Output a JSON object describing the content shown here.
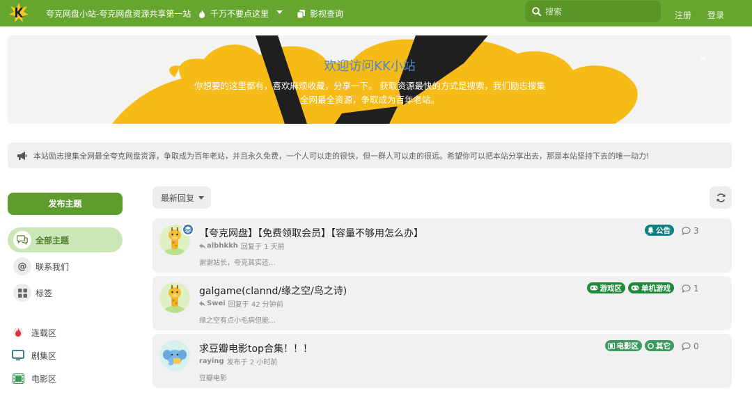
{
  "header": {
    "site_title": "夸克网盘小站-夸克网盘资源共享第一站",
    "nav": [
      {
        "label": "千万不要点这里",
        "icon": "fire-icon"
      },
      {
        "label": "影视查询",
        "icon": "copy-icon"
      }
    ],
    "search_placeholder": "搜索",
    "register": "注册",
    "login": "登录"
  },
  "hero": {
    "title": "欢迎访问KK小站",
    "text": "你想要的这里都有，喜欢麻烦收藏，分享一下。 获取资源最快的方式是搜索，我们励志搜集全网最全资源，争取成为百年老站。",
    "close": "×"
  },
  "notice": {
    "text": "本站励志搜集全网最全夸克网盘资源，争取成为百年老站，并且永久免费，一个人可以走的很快，但一群人可以走的很远。希望你可以把本站分享出去，那是本站坚持下去的唯一动力!"
  },
  "sidebar": {
    "post_button": "发布主题",
    "items": [
      {
        "label": "全部主题",
        "icon": "comments-icon",
        "active": true
      },
      {
        "label": "联系我们",
        "icon": "at-icon",
        "active": false
      },
      {
        "label": "标签",
        "icon": "grid-icon",
        "active": false
      }
    ],
    "categories": [
      {
        "label": "连载区",
        "icon": "fire-icon",
        "color": "#d9363e"
      },
      {
        "label": "剧集区",
        "icon": "tv-icon",
        "color": "#2b6f7a"
      },
      {
        "label": "电影区",
        "icon": "film-icon",
        "color": "#3f9a5f"
      }
    ]
  },
  "toolbar": {
    "sort_label": "最新回复",
    "refresh": "refresh-icon"
  },
  "discussions": [
    {
      "title": "【夸克网盘】【免费领取会员】【容量不够用怎么办】",
      "user": "albhkkh",
      "time": "回复于 1 天前",
      "excerpt": "谢谢站长，夸克其实还...",
      "replies": "3",
      "avatar": "giraffe",
      "pinned": true,
      "tags": [
        {
          "label": "公告",
          "color": "#0f7f80",
          "icon": "bell-icon"
        }
      ]
    },
    {
      "title": "galgame(clannd/缘之空/鸟之诗)",
      "user": "Swei",
      "time": "回复于 42 分钟前",
      "excerpt": "缘之空有点小毛病但能...",
      "replies": "1",
      "avatar": "giraffe",
      "pinned": false,
      "tags": [
        {
          "label": "游戏区",
          "color": "#1f8a3a",
          "icon": "gamepad-icon"
        },
        {
          "label": "单机游戏",
          "color": "#1f8a3a",
          "icon": "gamepad-icon"
        }
      ]
    },
    {
      "title": "求豆瓣电影top合集！！！",
      "user": "raying",
      "time": "发布于 2 小时前",
      "excerpt": "豆瓣电影",
      "replies": "0",
      "avatar": "elephant",
      "pinned": false,
      "tags": [
        {
          "label": "电影区",
          "color": "#3f9a5f",
          "icon": "film-icon"
        },
        {
          "label": "其它",
          "color": "#3f9a5f",
          "icon": "circle-icon"
        }
      ]
    }
  ]
}
